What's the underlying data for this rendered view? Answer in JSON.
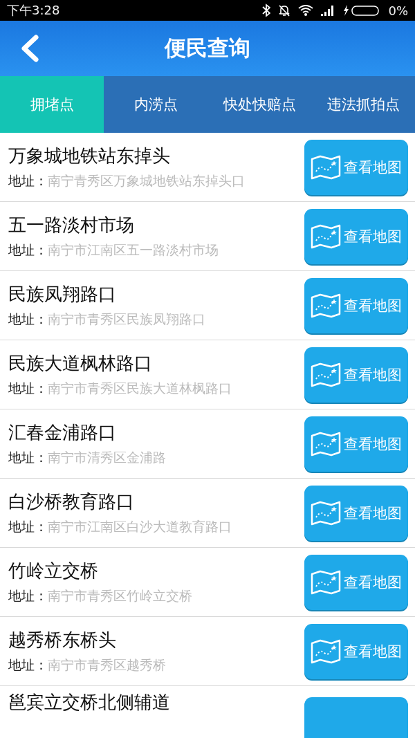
{
  "status_bar": {
    "time": "下午3:28",
    "battery": "0%"
  },
  "header": {
    "title": "便民查询"
  },
  "tabs": [
    {
      "label": "拥堵点",
      "selected": true
    },
    {
      "label": "内涝点",
      "selected": false
    },
    {
      "label": "快处快赔点",
      "selected": false
    },
    {
      "label": "违法抓拍点",
      "selected": false
    }
  ],
  "items": [
    {
      "name": "万象城地铁站东掉头",
      "address_label": "地址：",
      "address": "南宁青秀区万象城地铁站东掉头口",
      "button": "查看地图"
    },
    {
      "name": "五一路淡村市场",
      "address_label": "地址：",
      "address": "南宁市江南区五一路淡村市场",
      "button": "查看地图"
    },
    {
      "name": "民族凤翔路口",
      "address_label": "地址：",
      "address": "南宁市青秀区民族凤翔路口",
      "button": "查看地图"
    },
    {
      "name": "民族大道枫林路口",
      "address_label": "地址：",
      "address": "南宁市青秀区民族大道林枫路口",
      "button": "查看地图"
    },
    {
      "name": "汇春金浦路口",
      "address_label": "地址：",
      "address": "南宁市清秀区金浦路",
      "button": "查看地图"
    },
    {
      "name": "白沙桥教育路口",
      "address_label": "地址：",
      "address": "南宁市江南区白沙大道教育路口",
      "button": "查看地图"
    },
    {
      "name": "竹岭立交桥",
      "address_label": "地址：",
      "address": "南宁市青秀区竹岭立交桥",
      "button": "查看地图"
    },
    {
      "name": "越秀桥东桥头",
      "address_label": "地址：",
      "address": "南宁市青秀区越秀桥",
      "button": "查看地图"
    },
    {
      "name": "邕宾立交桥北侧辅道"
    }
  ]
}
